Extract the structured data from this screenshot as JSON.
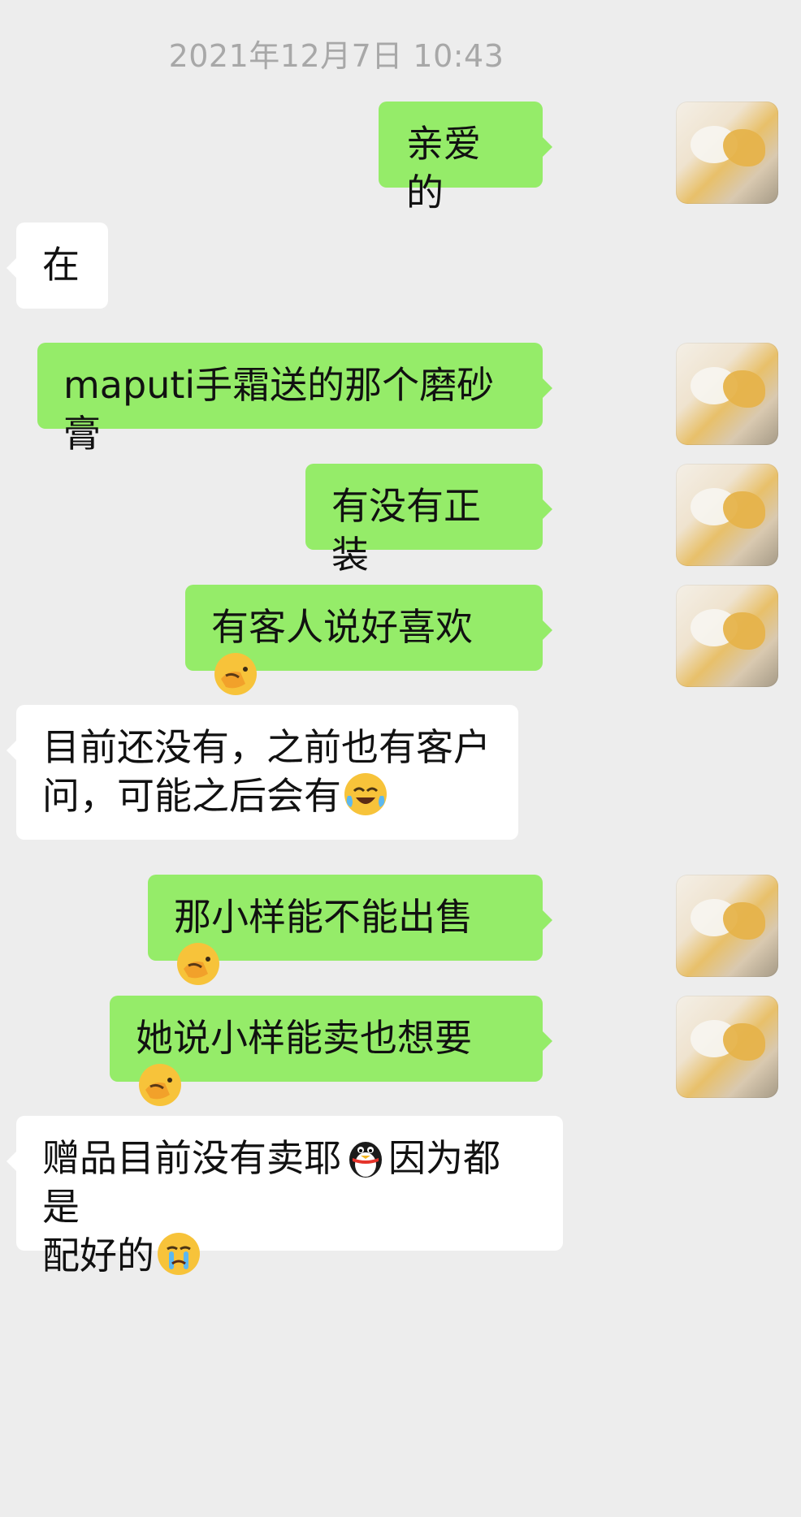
{
  "chat": {
    "timestamp": "2021年12月7日 10:43",
    "messages": [
      {
        "side": "out",
        "text": "亲爱的",
        "emoji": null
      },
      {
        "side": "in",
        "text": "在",
        "emoji": null
      },
      {
        "side": "out",
        "text": "maputi手霜送的那个磨砂膏",
        "emoji": null
      },
      {
        "side": "out",
        "text": "有没有正装",
        "emoji": null
      },
      {
        "side": "out",
        "text": "有客人说好喜欢",
        "emoji": "facepalm-emoji"
      },
      {
        "side": "in",
        "text_1": "目前还没有，之前也有客户",
        "text_2": "问，可能之后会有",
        "emoji": "tears-of-joy-emoji"
      },
      {
        "side": "out",
        "text": "那小样能不能出售",
        "emoji": "facepalm-emoji"
      },
      {
        "side": "out",
        "text": "她说小样能卖也想要",
        "emoji": "facepalm-emoji"
      },
      {
        "side": "in",
        "text_1": "赠品目前没有卖耶",
        "text_1b": "因为都是",
        "text_2": "配好的",
        "emoji": "crying-emoji",
        "inline_emoji": "penguin-emoji"
      }
    ]
  },
  "colors": {
    "outgoing_bubble": "#95ec69",
    "incoming_bubble": "#ffffff",
    "background": "#ededed",
    "timestamp": "#a8a8a8"
  }
}
